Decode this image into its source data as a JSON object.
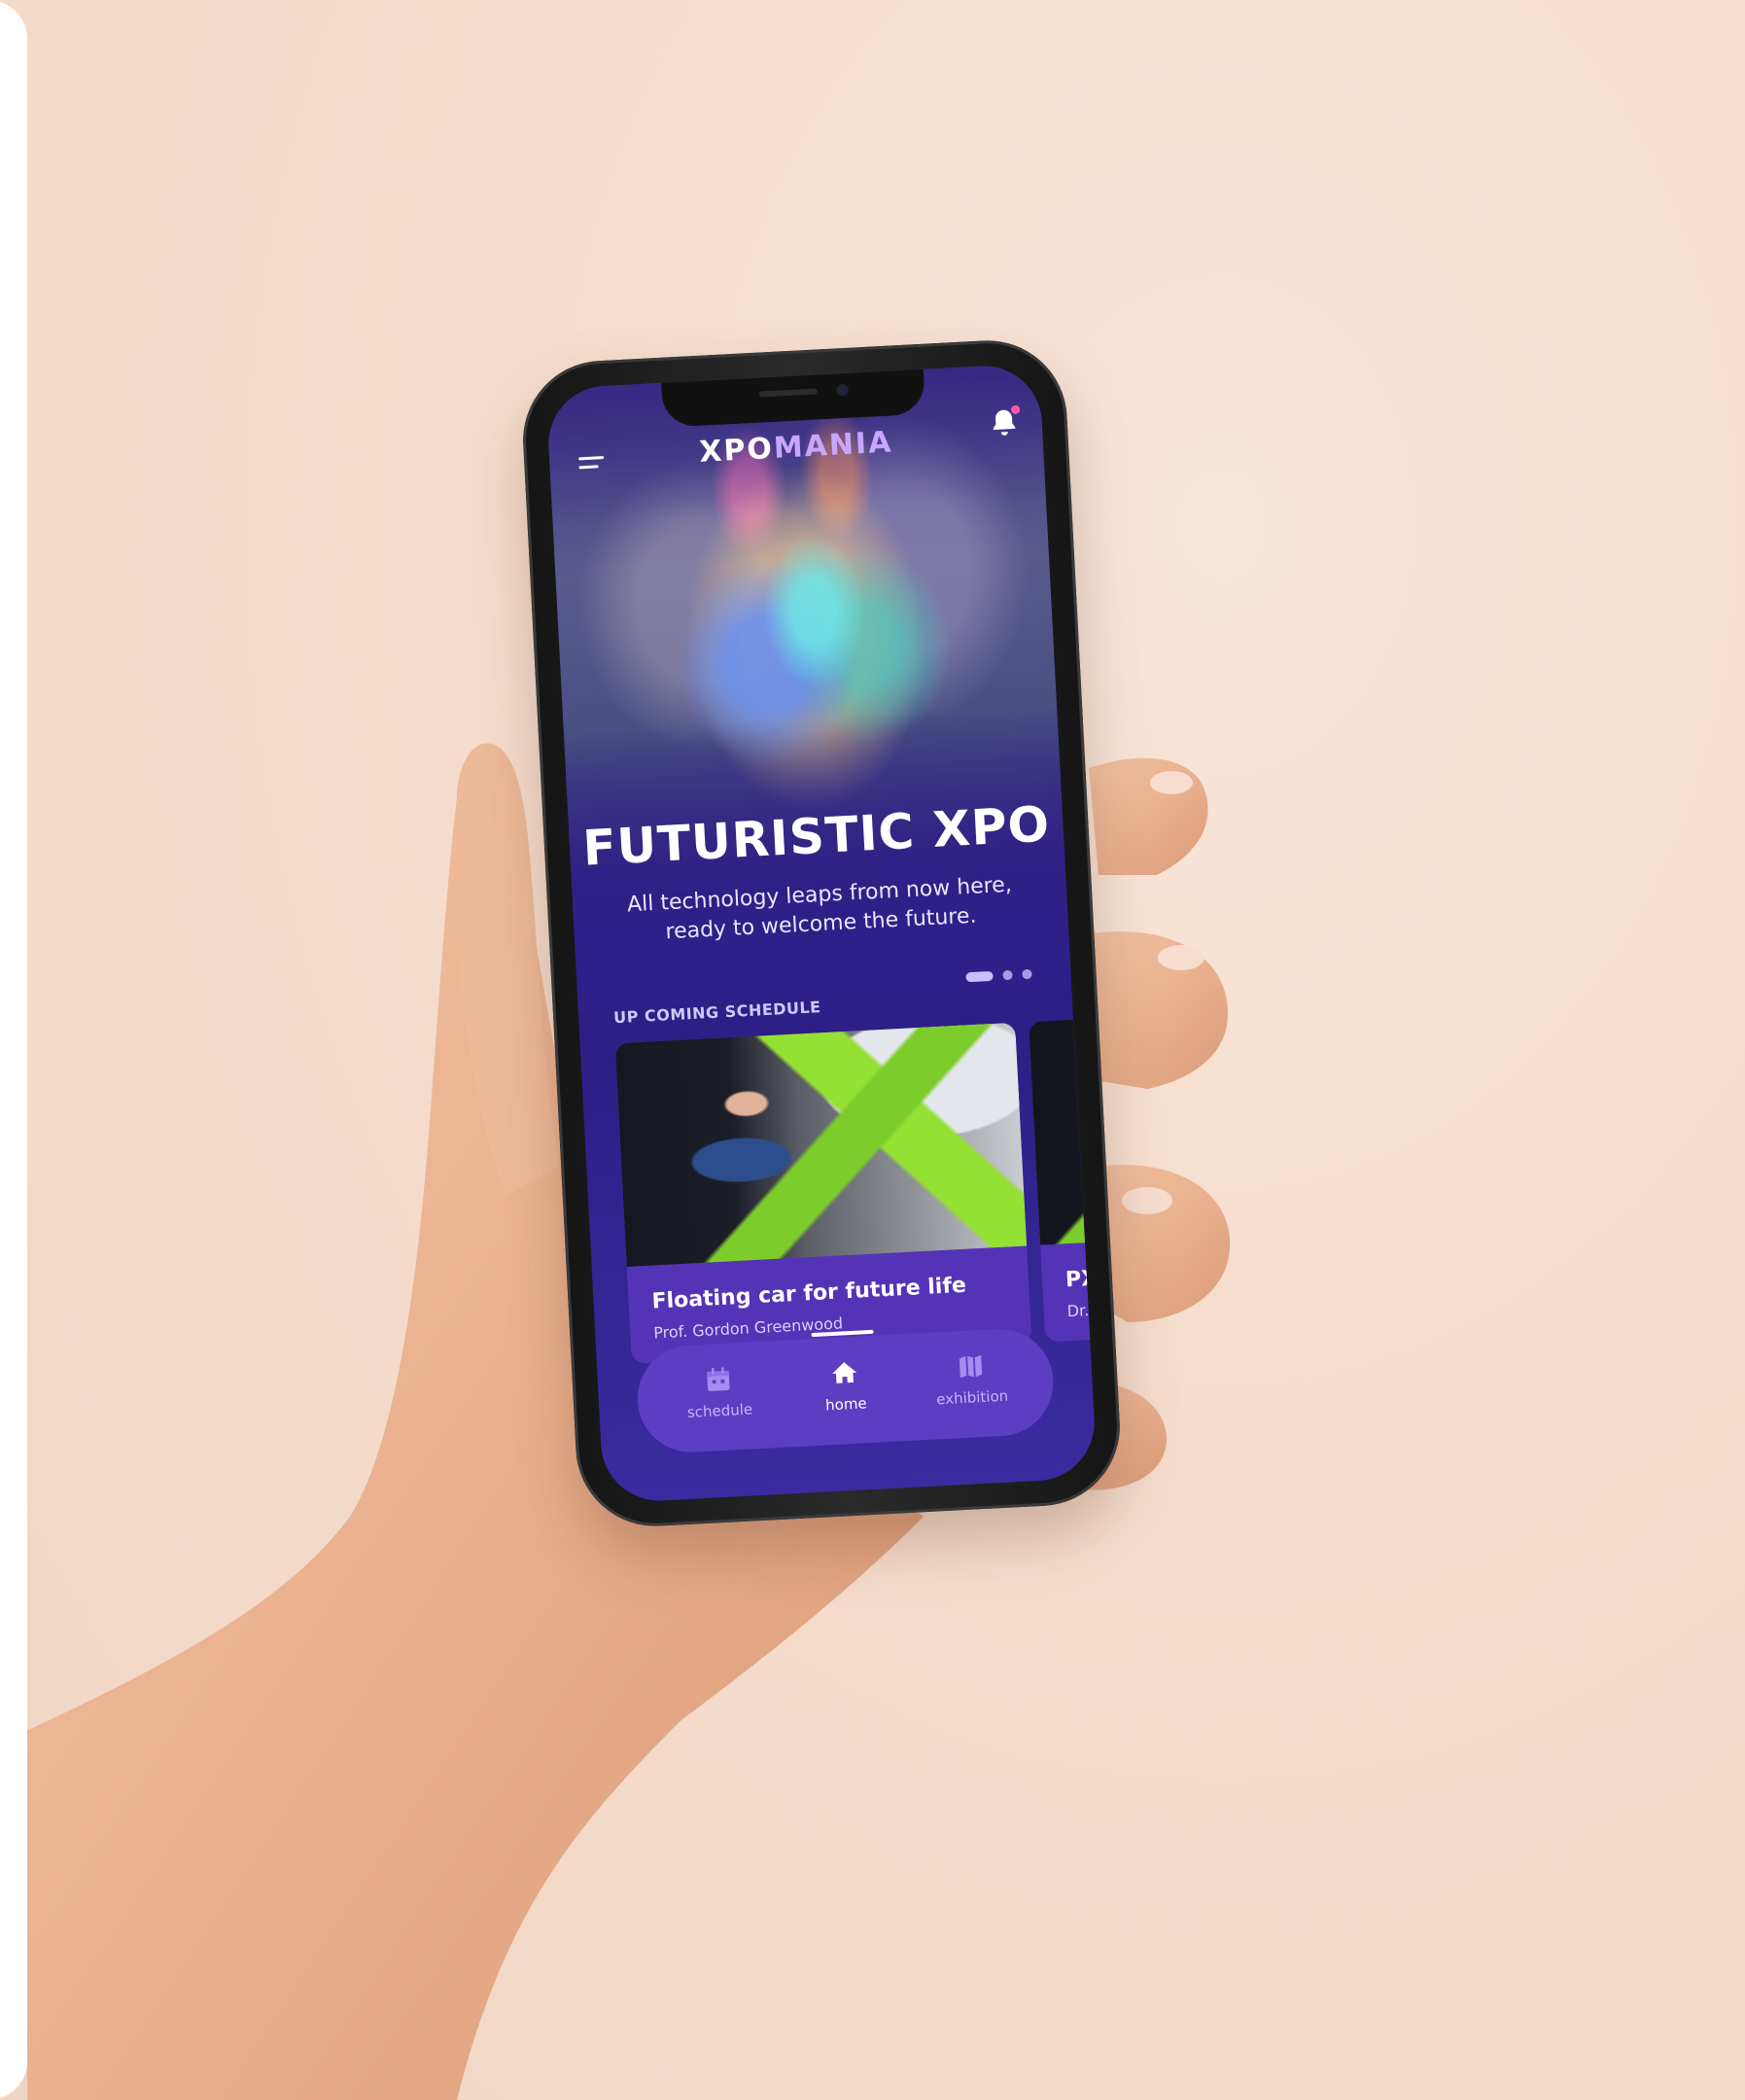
{
  "app": {
    "brand_part1": "XPO",
    "brand_part2": "MANIA"
  },
  "hero": {
    "title": "FUTURISTIC XPO",
    "subtitle_line1": "All technology leaps from now here,",
    "subtitle_line2": "ready to welcome the future.",
    "carousel_total": 3,
    "carousel_active": 1
  },
  "schedule": {
    "section_label": "UP COMING SCHEDULE",
    "cards": [
      {
        "title": "Floating car for future life",
        "speaker": "Prof. Gordon Greenwood"
      },
      {
        "title": "PX",
        "speaker": "Dr. ."
      }
    ]
  },
  "nav": {
    "items": [
      {
        "label": "schedule",
        "icon": "calendar-icon",
        "active": false
      },
      {
        "label": "home",
        "icon": "home-icon",
        "active": true
      },
      {
        "label": "exhibition",
        "icon": "map-icon",
        "active": false
      }
    ]
  },
  "colors": {
    "background": "#f5dccc",
    "screen_primary": "#2e2088",
    "card": "#5434b6",
    "navbar": "#5b3ec2",
    "accent": "#c7a6ff",
    "notification_dot": "#ff5aa8"
  }
}
